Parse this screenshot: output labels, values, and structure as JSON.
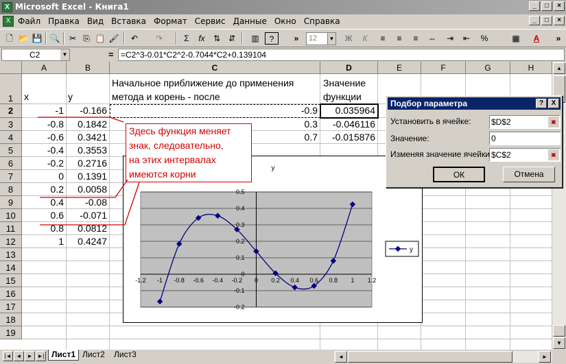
{
  "window": {
    "title": "Microsoft Excel - Книга1",
    "app_icon": "excel-icon"
  },
  "menu": [
    "Файл",
    "Правка",
    "Вид",
    "Вставка",
    "Формат",
    "Сервис",
    "Данные",
    "Окно",
    "Справка"
  ],
  "toolbar": {
    "font_size": "12",
    "bold": "Ж",
    "italic": "К",
    "sigma": "Σ",
    "fx": "fx"
  },
  "formula_bar": {
    "name_box": "C2",
    "equals": "=",
    "formula": "=C2^3-0.01*C2^2-0.7044*C2+0.139104"
  },
  "columns": [
    "A",
    "B",
    "C",
    "D",
    "E",
    "F",
    "G",
    "H"
  ],
  "rows": [
    "1",
    "2",
    "3",
    "4",
    "5",
    "6",
    "7",
    "8",
    "9",
    "10",
    "11",
    "12",
    "13",
    "14",
    "15",
    "16",
    "17",
    "18",
    "19"
  ],
  "cells": {
    "a1": "x",
    "b1": "y",
    "c1_line1": "Начальное приближение до применения",
    "c1_line2": "метода и корень - после",
    "d1_line1": "Значение",
    "d1_line2": "функции",
    "col_a": [
      "-1",
      "-0.8",
      "-0.6",
      "-0.4",
      "-0.2",
      "0",
      "0.2",
      "0.4",
      "0.6",
      "0.8",
      "1"
    ],
    "col_b": [
      "-0.166",
      "0.1842",
      "0.3421",
      "0.3553",
      "0.2716",
      "0.1391",
      "0.0058",
      "-0.08",
      "-0.071",
      "0.0812",
      "0.4247"
    ],
    "col_c": [
      "-0.9",
      "0.3",
      "0.7"
    ],
    "col_d": [
      "0.035964",
      "-0.046116",
      "-0.015876"
    ]
  },
  "callout": {
    "lines": [
      "Здесь функция меняет",
      "знак, следовательно,",
      "на этих интервалах",
      "имеются корни"
    ],
    "color": "#d00000"
  },
  "chart_data": {
    "type": "scatter",
    "title": "y",
    "x": [
      -1,
      -0.8,
      -0.6,
      -0.4,
      -0.2,
      0,
      0.2,
      0.4,
      0.6,
      0.8,
      1
    ],
    "series": [
      {
        "name": "y",
        "values": [
          -0.166,
          0.1842,
          0.3421,
          0.3553,
          0.2716,
          0.1391,
          0.0058,
          -0.08,
          -0.071,
          0.0812,
          0.4247
        ]
      }
    ],
    "xlim": [
      -1.2,
      1.2
    ],
    "ylim": [
      -0.2,
      0.5
    ],
    "x_ticks": [
      "-1.2",
      "-1",
      "-0.8",
      "-0.6",
      "-0.4",
      "-0.2",
      "0",
      "0.2",
      "0.4",
      "0.6",
      "0.8",
      "1",
      "1.2"
    ],
    "y_ticks": [
      "-0.2",
      "-0.1",
      "0",
      "0.1",
      "0.2",
      "0.3",
      "0.4",
      "0.5"
    ],
    "legend": "right",
    "plot_color": "#c0c0c0",
    "line_color": "#000080",
    "grid": true
  },
  "dialog": {
    "title": "Подбор параметра",
    "help": "?",
    "close": "X",
    "set_cell_label": "Установить в ячейке:",
    "set_cell_value": "$D$2",
    "value_label": "Значение:",
    "value_value": "0",
    "changing_label": "Изменяя значение ячейки:",
    "changing_value": "$C$2",
    "ok": "ОК",
    "cancel": "Отмена"
  },
  "sheets": [
    "Лист1",
    "Лист2",
    "Лист3"
  ]
}
